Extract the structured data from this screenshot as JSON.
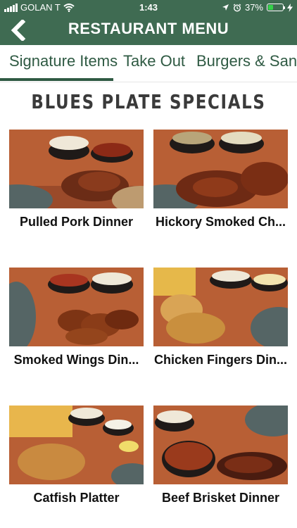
{
  "status_bar": {
    "carrier": "GOLAN T",
    "time": "1:43",
    "battery_percent": "37%",
    "battery_level": 0.37
  },
  "nav": {
    "title": "RESTAURANT MENU",
    "back_icon": "chevron-left-icon"
  },
  "tabs": [
    {
      "label": "Signature Items",
      "selected": true
    },
    {
      "label": "Take Out",
      "selected": false
    },
    {
      "label": "Burgers & Sandw",
      "selected": false
    }
  ],
  "section": {
    "title": "BLUES PLATE SPECIALS"
  },
  "items": [
    {
      "name": "Pulled Pork Dinner"
    },
    {
      "name": "Hickory Smoked Ch..."
    },
    {
      "name": "Smoked Wings Din..."
    },
    {
      "name": "Chicken Fingers Din..."
    },
    {
      "name": "Catfish Platter"
    },
    {
      "name": "Beef Brisket Dinner"
    }
  ],
  "colors": {
    "brand_green": "#3f6b52",
    "tab_text": "#2f5a43",
    "board_wood": "#b85f35",
    "towel": "#556565"
  }
}
